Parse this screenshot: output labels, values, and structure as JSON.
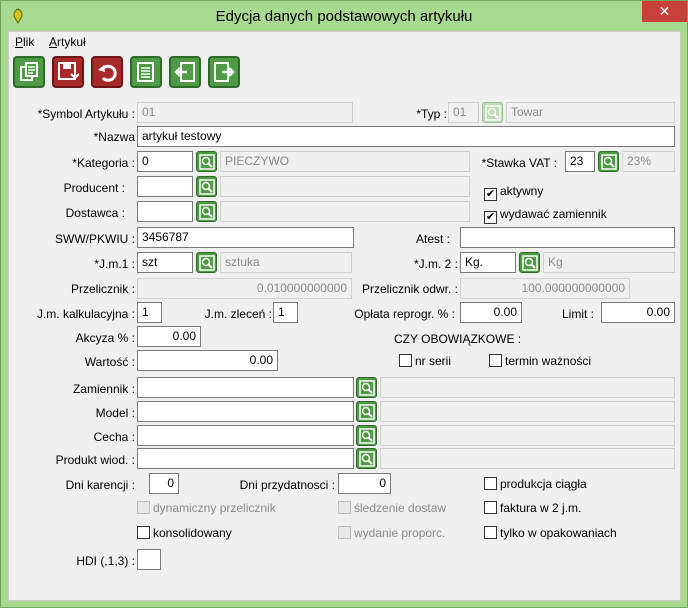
{
  "window": {
    "title": "Edycja danych podstawowych artykułu",
    "close_glyph": "✕"
  },
  "menu": {
    "plik": "Plik",
    "plik_ul": "P",
    "plik_rest": "lik",
    "artykul_ul": "A",
    "artykul_rest": "rtykuł"
  },
  "toolbar": [
    "copy-icon",
    "save-icon",
    "undo-icon",
    "list-icon",
    "prev-icon",
    "next-icon"
  ],
  "fields": {
    "symbol": {
      "label": "*Symbol Artykułu :",
      "value": "01"
    },
    "typ": {
      "label": "*Typ :",
      "code": "01",
      "name": "Towar"
    },
    "nazwa": {
      "label": "*Nazwa",
      "value": "artykuł testowy"
    },
    "kategoria": {
      "label": "*Kategoria :",
      "code": "0",
      "name": "PIECZYWO"
    },
    "stawka_vat": {
      "label": "*Stawka VAT :",
      "code": "23",
      "name": "23%"
    },
    "producent": {
      "label": "Producent :",
      "code": "",
      "name": ""
    },
    "dostawca": {
      "label": "Dostawca :",
      "code": "",
      "name": ""
    },
    "sww": {
      "label": "SWW/PKWIU :",
      "value": "3456787"
    },
    "atest": {
      "label": "Atest :",
      "value": ""
    },
    "jm1": {
      "label": "*J.m.1 :",
      "code": "szt",
      "name": "sztuka"
    },
    "jm2": {
      "label": "*J.m. 2 :",
      "code": "Kg.",
      "name": "Kg"
    },
    "przelicznik": {
      "label": "Przelicznik :",
      "value": "0.010000000000"
    },
    "przelicznik_odwr": {
      "label": "Przelicznik odwr. :",
      "value": "100.000000000000"
    },
    "jm_kalk": {
      "label": "J.m. kalkulacyjna :",
      "value": "1"
    },
    "jm_zlecen": {
      "label": "J.m. zleceń :",
      "value": "1"
    },
    "oplata": {
      "label": "Opłata reprogr. % :",
      "value": "0.00"
    },
    "limit": {
      "label": "Limit :",
      "value": "0.00"
    },
    "akcyza": {
      "label": "Akcyza % :",
      "value": "0.00"
    },
    "wartosc": {
      "label": "Wartość :",
      "value": "0.00"
    },
    "zamiennik": {
      "label": "Zamiennik :"
    },
    "model": {
      "label": "Model :"
    },
    "cecha": {
      "label": "Cecha :"
    },
    "produkt_wiod": {
      "label": "Produkt wiod. :"
    },
    "dni_karencji": {
      "label": "Dni karencji :",
      "value": "0"
    },
    "dni_przydatnosci": {
      "label": "Dni przydatnosci :",
      "value": "0"
    },
    "hdi": {
      "label": "HDI (,1,3) :",
      "value": ""
    }
  },
  "checks": {
    "aktywny": {
      "label": "aktywny",
      "checked": true
    },
    "wydawac": {
      "label": "wydawać zamiennik",
      "checked": true
    },
    "czy_obowiazkowe": "CZY OBOWIĄZKOWE :",
    "nr_serii": {
      "label": "nr serii",
      "checked": false
    },
    "termin": {
      "label": "termin ważności",
      "checked": false
    },
    "produkcja": {
      "label": "produkcja ciągła",
      "checked": false
    },
    "faktura": {
      "label": "faktura w 2 j.m.",
      "checked": false
    },
    "tylko": {
      "label": "tylko w opakowaniach",
      "checked": false
    },
    "dynamiczny": {
      "label": "dynamiczny przelicznik",
      "checked": false
    },
    "sledzenie": {
      "label": "śledzenie dostaw",
      "checked": false
    },
    "konsolidowany": {
      "label": "konsolidowany",
      "checked": false
    },
    "wydanie": {
      "label": "wydanie proporc.",
      "checked": false
    }
  },
  "check_mark": "✔"
}
